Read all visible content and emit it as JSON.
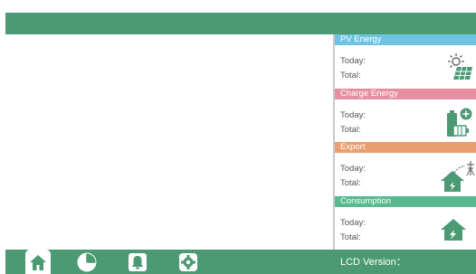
{
  "sections": [
    {
      "title": "PV Energy",
      "today_label": "Today:",
      "total_label": "Total:",
      "icon": "solar-panel-icon",
      "color": "#6ec3e2"
    },
    {
      "title": "Charge Energy",
      "today_label": "Today:",
      "total_label": "Total:",
      "icon": "battery-charge-icon",
      "color": "#e68fa1"
    },
    {
      "title": "Export",
      "today_label": "Today:",
      "total_label": "Total:",
      "icon": "grid-export-icon",
      "color": "#eb9e6e"
    },
    {
      "title": "Consumption",
      "today_label": "Today:",
      "total_label": "Total:",
      "icon": "home-consumption-icon",
      "color": "#58b98e"
    }
  ],
  "bottom_bar": {
    "lcd_version_label": "LCD Version：",
    "nav": [
      {
        "icon": "home-icon",
        "active": true
      },
      {
        "icon": "pie-chart-icon",
        "active": false
      },
      {
        "icon": "bell-icon",
        "active": false
      },
      {
        "icon": "gear-icon",
        "active": false
      }
    ]
  },
  "colors": {
    "top_bar": "#4c9a74",
    "bottom_bar": "#4c9a74",
    "accent_icon": "#4c9a74"
  }
}
